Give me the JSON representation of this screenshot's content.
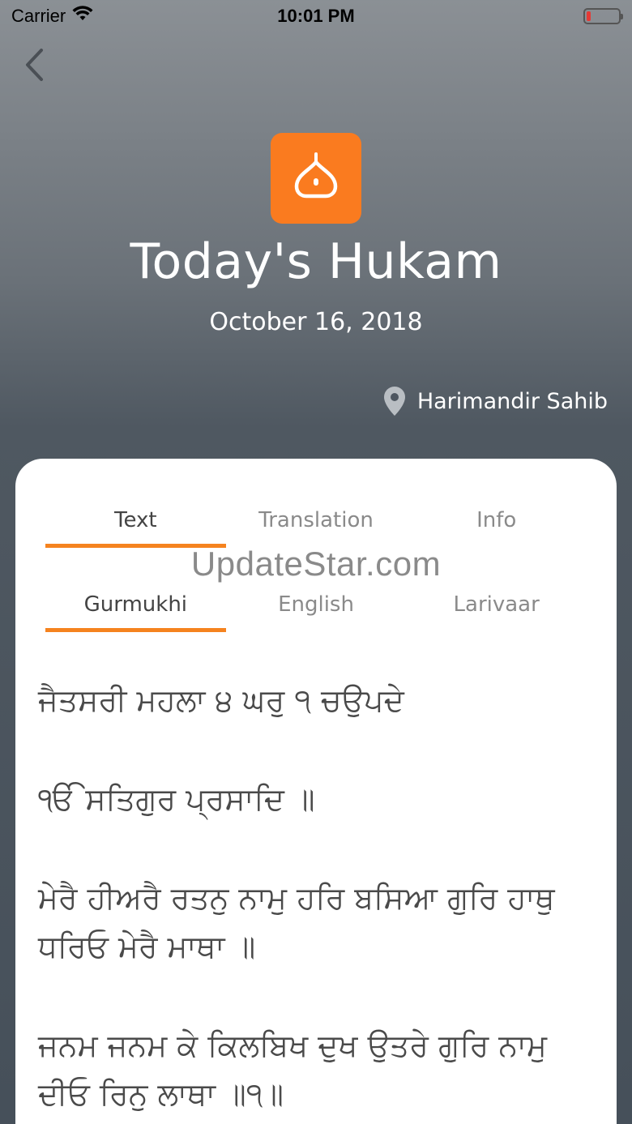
{
  "status_bar": {
    "carrier": "Carrier",
    "time": "10:01 PM",
    "battery_level": 0.12
  },
  "header": {
    "back_icon": "chevron-left-icon",
    "app_icon": "dome-icon",
    "title": "Today's Hukam",
    "date": "October 16, 2018",
    "location_icon": "map-pin-icon",
    "location": "Harimandir Sahib"
  },
  "colors": {
    "accent": "#f5831f",
    "app_icon_bg": "#fa7b1f"
  },
  "card": {
    "tabs": [
      {
        "label": "Text",
        "active": true
      },
      {
        "label": "Translation",
        "active": false
      },
      {
        "label": "Info",
        "active": false
      }
    ],
    "subtabs": [
      {
        "label": "Gurmukhi",
        "active": true
      },
      {
        "label": "English",
        "active": false
      },
      {
        "label": "Larivaar",
        "active": false
      }
    ],
    "watermark": "UpdateStar.com",
    "verses": [
      "ਜੈਤਸਰੀ ਮਹਲਾ ੪ ਘਰੁ ੧ ਚਉਪਦੇ",
      "ੴ ਸਤਿਗੁਰ ਪ੍ਰਸਾਦਿ ॥",
      "ਮੇਰੈ ਹੀਅਰੈ ਰਤਨੁ ਨਾਮੁ ਹਰਿ ਬਸਿਆ ਗੁਰਿ ਹਾਥੁ ਧਰਿਓ ਮੇਰੈ ਮਾਥਾ ॥",
      "ਜਨਮ ਜਨਮ ਕੇ ਕਿਲਬਿਖ ਦੁਖ ਉਤਰੇ ਗੁਰਿ ਨਾਮੁ ਦੀਓ ਰਿਨੁ ਲਾਥਾ ॥੧॥"
    ]
  }
}
